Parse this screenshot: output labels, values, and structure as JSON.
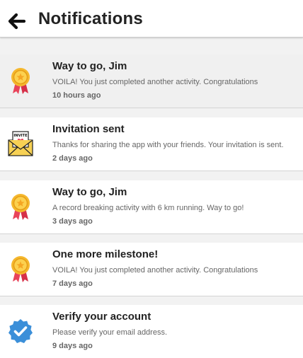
{
  "header": {
    "title": "Notifications",
    "back_icon": "arrow-left-icon"
  },
  "notifications": [
    {
      "icon": "medal-icon",
      "title": "Way to go, Jim",
      "message": "VOILA! You just completed another activity. Congratulations",
      "time": "10 hours ago",
      "highlighted": true
    },
    {
      "icon": "invite-envelope-icon",
      "icon_text": "INVITE",
      "title": "Invitation sent",
      "message": "Thanks for sharing the app with your friends. Your invitation is sent.",
      "time": "2 days ago",
      "highlighted": false
    },
    {
      "icon": "medal-icon",
      "title": "Way to go, Jim",
      "message": "A record breaking activity with 6 km running. Way to go!",
      "time": "3 days ago",
      "highlighted": false
    },
    {
      "icon": "medal-icon",
      "title": "One more milestone!",
      "message": "VOILA! You just completed another activity. Congratulations",
      "time": "7 days ago",
      "highlighted": false
    },
    {
      "icon": "verified-badge-icon",
      "title": "Verify your account",
      "message": "Please verify your email address.",
      "time": "9 days ago",
      "highlighted": false
    }
  ],
  "colors": {
    "medal_gold": "#f5b82e",
    "medal_ribbon": "#e8435a",
    "envelope": "#f7d154",
    "verified_blue": "#3b8fd9"
  }
}
